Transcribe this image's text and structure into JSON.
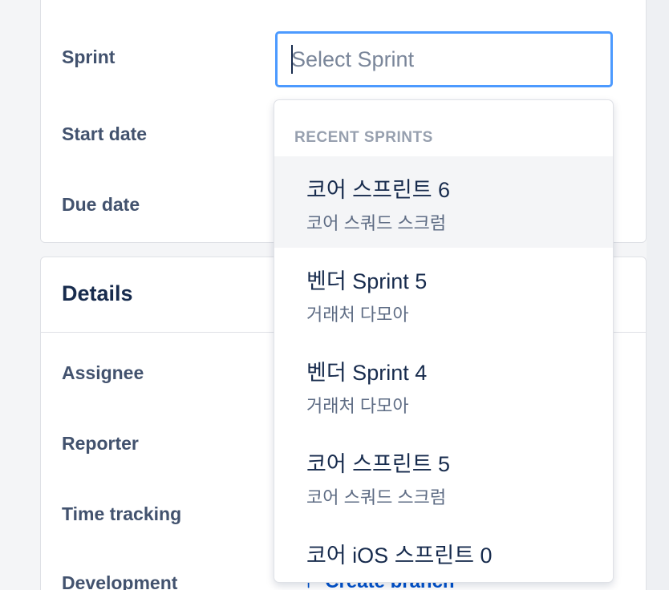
{
  "top_panel": {
    "fields": [
      {
        "label": "Sprint"
      },
      {
        "label": "Start date"
      },
      {
        "label": "Due date"
      }
    ]
  },
  "sprint_select": {
    "placeholder": "Select Sprint",
    "value": ""
  },
  "details": {
    "title": "Details",
    "fields": [
      {
        "label": "Assignee"
      },
      {
        "label": "Reporter"
      },
      {
        "label": "Time tracking"
      },
      {
        "label": "Development"
      }
    ],
    "create_branch_label": "Create branch"
  },
  "dropdown": {
    "group_heading": "RECENT SPRINTS",
    "options": [
      {
        "title": "코어 스프린트 6",
        "board": "코어 스쿼드 스크럼",
        "highlighted": true
      },
      {
        "title": "벤더 Sprint 5",
        "board": "거래처 다모아",
        "highlighted": false
      },
      {
        "title": "벤더 Sprint 4",
        "board": "거래처 다모아",
        "highlighted": false
      },
      {
        "title": "코어 스프린트 5",
        "board": "코어 스쿼드 스크럼",
        "highlighted": false
      },
      {
        "title": "코어 iOS 스프린트 0",
        "board": "",
        "highlighted": false
      }
    ]
  },
  "colors": {
    "focus_border": "#4c9aff",
    "link": "#0052cc",
    "highlight_bg": "#f4f5f7"
  }
}
